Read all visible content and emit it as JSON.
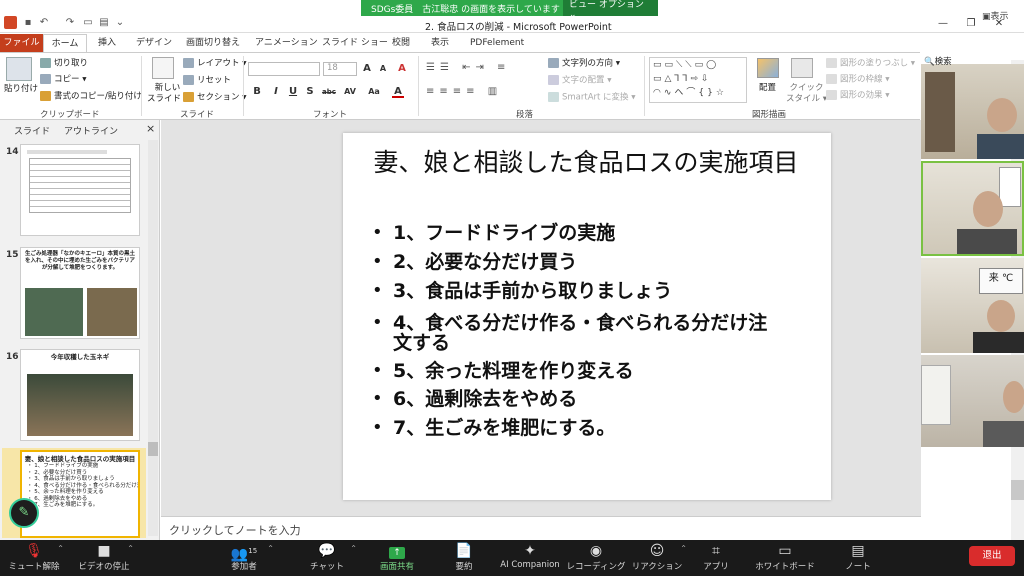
{
  "share_banner": {
    "presenter": "SDGs委員　古江聡忠 の画面を表示しています",
    "view_options": "ビュー オプション ⌄"
  },
  "window": {
    "title": "2. 食品ロスの削減 - Microsoft PowerPoint",
    "zoom_badge": "▣表示",
    "minimize": "—",
    "restore": "❐",
    "close": "✕",
    "help": "?"
  },
  "tabs": [
    "ファイル",
    "ホーム",
    "挿入",
    "デザイン",
    "画面切り替え",
    "アニメーション",
    "スライド ショー",
    "校閲",
    "表示",
    "PDFelement"
  ],
  "ribbon": {
    "clipboard": {
      "paste": "貼り付け",
      "cut": "切り取り",
      "copy": "コピー ▾",
      "format_painter": "書式のコピー/貼り付け",
      "label": "クリップボード"
    },
    "slides": {
      "new_slide": "新しい\nスライド ▾",
      "layout": "レイアウト ▾",
      "reset": "リセット",
      "section": "セクション ▾",
      "label": "スライド"
    },
    "font": {
      "size": "18",
      "label": "フォント",
      "bold": "B",
      "italic": "I",
      "underline": "U",
      "shadow": "S",
      "strike": "abc",
      "spacing": "AV",
      "case": "Aa",
      "color": "A",
      "grow": "A",
      "shrink": "A",
      "clear": "A"
    },
    "paragraph": {
      "text_direction": "文字列の方向 ▾",
      "align_text": "文字の配置 ▾",
      "smartart": "SmartArt に変換 ▾",
      "label": "段落"
    },
    "drawing": {
      "arrange": "配置",
      "quick_style": "クイック\nスタイル ▾",
      "fill": "図形の塗りつぶし ▾",
      "outline": "図形の枠線 ▾",
      "effect": "図形の効果 ▾",
      "label": "図形描画",
      "shapes_row1": "▭▭⟍⟍▭◯",
      "shapes_row2": "▭△⅂⅂⇨⇩",
      "shapes_row3": "◠∿ヘ⌒{}☆"
    },
    "search": "検索"
  },
  "panel": {
    "tab_slides": "スライド",
    "tab_outline": "アウトライン",
    "close": "×"
  },
  "thumbnails": [
    {
      "num": "14",
      "title": "",
      "lines": []
    },
    {
      "num": "15",
      "title": "生ごみ処理器「なかのキエーロ」本質の黒土を入れ、その中に埋めた生ごみをバクテリアが分解して堆肥をつくります。",
      "lines": []
    },
    {
      "num": "16",
      "title": "今年収穫した玉ネギ",
      "lines": []
    },
    {
      "num": "17",
      "title": "妻、娘と相談した食品ロスの実施項目",
      "lines": [
        "・ 1、フードドライブの実施",
        "・ 2、必要な分だけ買う",
        "・ 3、食品は手前から取りましょう",
        "・ 4、食べる分だけ作る・食べられる分だけ注文する",
        "・ 5、余った料理を作り変える",
        "・ 6、過剰除去をやめる",
        "・ 7、生ごみを堆肥にする。"
      ]
    }
  ],
  "slide": {
    "title": "妻、娘と相談した食品ロスの実施項目",
    "bullet_marker": "•",
    "bullets": [
      "1、フードドライブの実施",
      "2、必要な分だけ買う",
      "3、食品は手前から取りましょう",
      "4、食べる分だけ作る・食べられる分だけ注",
      "文する",
      "5、余った料理を作り変える",
      "6、過剰除去をやめる",
      "7、生ごみを堆肥にする。"
    ]
  },
  "notes_placeholder": "クリックしてノートを入力",
  "video_tiles": [
    {
      "label": "participant-1"
    },
    {
      "label": "participant-2"
    },
    {
      "label": "participant-3"
    },
    {
      "label": "participant-4"
    }
  ],
  "zoom_toolbar": {
    "mute": "ミュート解除",
    "video": "ビデオの停止",
    "participants": "参加者",
    "participants_count": "15",
    "chat": "チャット",
    "share": "画面共有",
    "summary": "要約",
    "ai": "AI Companion",
    "record": "レコーディング",
    "reactions": "リアクション",
    "apps": "アプリ",
    "whiteboard": "ホワイトボード",
    "notes": "ノート",
    "leave": "退出"
  },
  "colors": {
    "file_tab": "#c43e1c",
    "share_green": "#2ea84a",
    "leave_red": "#d92c2c",
    "toolbar_bg": "#1a1a1a",
    "thumb_selected": "#f0b400"
  }
}
